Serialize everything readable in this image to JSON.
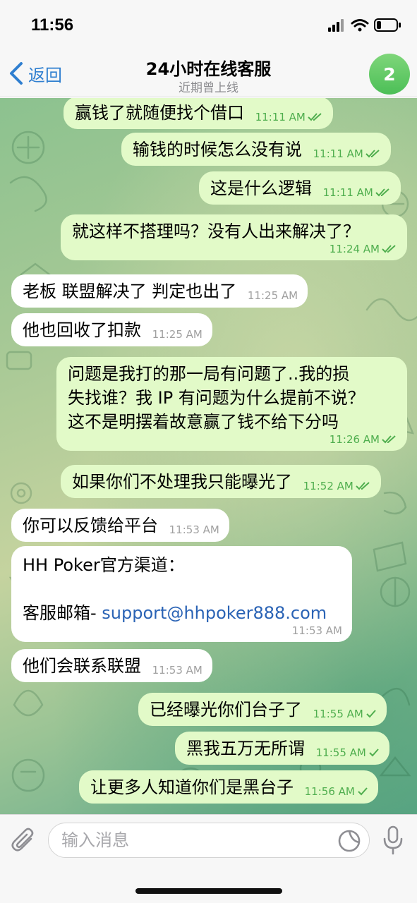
{
  "status_bar": {
    "time": "11:56",
    "icons": [
      "signal-icon",
      "wifi-icon",
      "battery-icon"
    ]
  },
  "header": {
    "back_label": "返回",
    "title": "24小时在线客服",
    "subtitle": "近期曾上线",
    "badge_count": "2"
  },
  "colors": {
    "accent": "#2f7fd0",
    "outgoing_bubble": "#e2fac8",
    "incoming_bubble": "#ffffff",
    "outgoing_meta": "#4fae4e",
    "incoming_meta": "#a0a0a0",
    "link": "#2a63b5",
    "avatar": "#4cbf57"
  },
  "messages": [
    {
      "direction": "out",
      "text": "赢钱了就随便找个借口",
      "time": "11:11 AM",
      "status": "read"
    },
    {
      "direction": "out",
      "text": "输钱的时候怎么没有说",
      "time": "11:11 AM",
      "status": "read"
    },
    {
      "direction": "out",
      "text": "这是什么逻辑",
      "time": "11:11 AM",
      "status": "read"
    },
    {
      "direction": "out",
      "text": "就这样不搭理吗？没有人出来解决了？",
      "time": "11:24 AM",
      "status": "read"
    },
    {
      "direction": "in",
      "text": "老板 联盟解决了 判定也出了",
      "time": "11:25 AM"
    },
    {
      "direction": "in",
      "text": "他也回收了扣款",
      "time": "11:25 AM"
    },
    {
      "direction": "out",
      "text": "问题是我打的那一局有问题了..我的损失找谁？我 IP 有问题为什么提前不说？这不是明摆着故意赢了钱不给下分吗",
      "lines": [
        "问题是我打的那一局有问题了..我的损",
        "失找谁？我 IP 有问题为什么提前不说？",
        "这不是明摆着故意赢了钱不给下分吗"
      ],
      "time": "11:26 AM",
      "status": "read"
    },
    {
      "direction": "out",
      "text": "如果你们不处理我只能曝光了",
      "time": "11:52 AM",
      "status": "read"
    },
    {
      "direction": "in",
      "text": "你可以反馈给平台",
      "time": "11:53 AM"
    },
    {
      "direction": "in",
      "line1": "HH Poker官方渠道：",
      "line2_prefix": "客服邮箱- ",
      "link": "support@hhpoker888.com",
      "time": "11:53 AM"
    },
    {
      "direction": "in",
      "text": "他们会联系联盟",
      "time": "11:53 AM"
    },
    {
      "direction": "out",
      "text": "已经曝光你们台子了",
      "time": "11:55 AM",
      "status": "sent"
    },
    {
      "direction": "out",
      "text": "黑我五万无所谓",
      "time": "11:55 AM",
      "status": "sent"
    },
    {
      "direction": "out",
      "text": "让更多人知道你们是黑台子",
      "time": "11:56 AM",
      "status": "sent"
    }
  ],
  "input": {
    "placeholder": "输入消息",
    "value": ""
  }
}
